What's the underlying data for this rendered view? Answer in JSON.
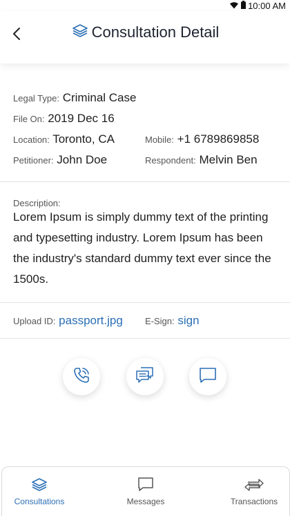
{
  "status_bar": {
    "time": "10:00 AM",
    "icons": [
      "wifi-icon",
      "battery-icon"
    ]
  },
  "header": {
    "title": "Consultation Detail",
    "back_icon": "chevron-left-icon",
    "title_icon": "layers-icon"
  },
  "details": {
    "legal_type": {
      "label": "Legal Type:",
      "value": "Criminal Case"
    },
    "file_on": {
      "label": "File On:",
      "value": "2019 Dec 16"
    },
    "location": {
      "label": "Location:",
      "value": "Toronto, CA"
    },
    "mobile": {
      "label": "Mobile:",
      "value": "+1 6789869858"
    },
    "petitioner": {
      "label": "Petitioner:",
      "value": "John Doe"
    },
    "respondent": {
      "label": "Respondent:",
      "value": "Melvin Ben"
    }
  },
  "description": {
    "label": "Description:",
    "text": "Lorem Ipsum is simply dummy text of the printing and typesetting industry. Lorem Ipsum has been the industry's standard dummy text ever since the 1500s."
  },
  "attachments": {
    "upload_label": "Upload ID:",
    "upload_value": "passport.jpg",
    "esign_label": "E-Sign:",
    "esign_value": "sign"
  },
  "actions": [
    "phone-icon",
    "chat-bubbles-icon",
    "message-icon"
  ],
  "bottom_nav": [
    {
      "label": "Consultations",
      "icon": "layers-icon",
      "active": true
    },
    {
      "label": "Messages",
      "icon": "message-icon",
      "active": false
    },
    {
      "label": "Transactions",
      "icon": "transfer-arrows-icon",
      "active": false
    }
  ],
  "colors": {
    "accent": "#2b6fb5",
    "text": "#1e1e1e",
    "divider": "#e3e3e3"
  }
}
